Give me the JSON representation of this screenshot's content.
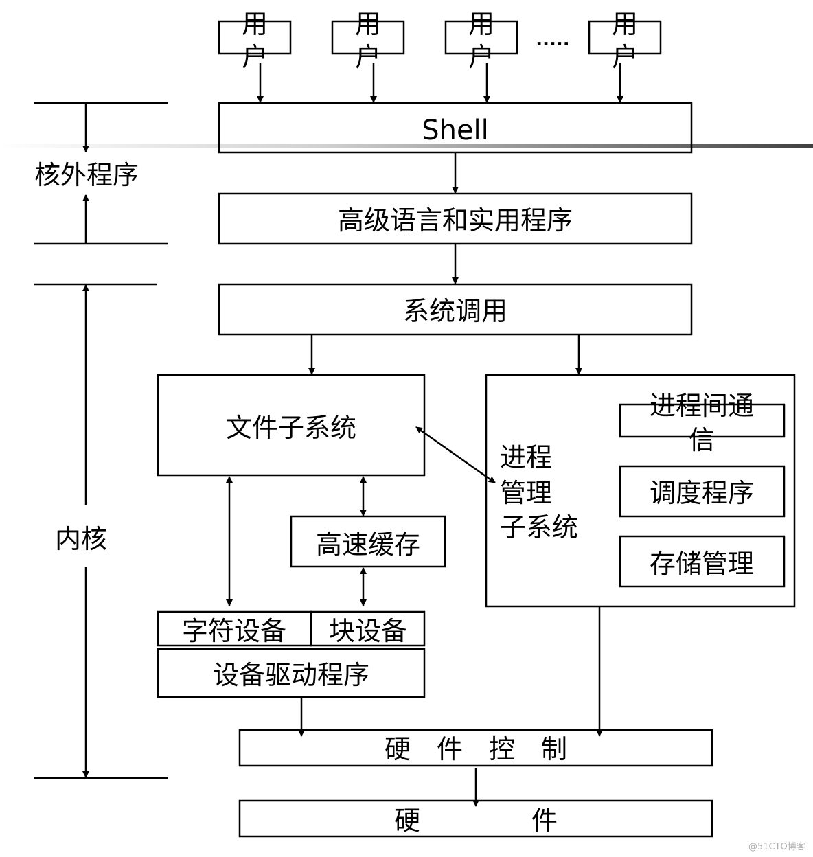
{
  "users": [
    {
      "line1": "用",
      "line2": "户"
    },
    {
      "line1": "用",
      "line2": "户"
    },
    {
      "line1": "用",
      "line2": "户"
    },
    {
      "line1": "用",
      "line2": "户"
    }
  ],
  "ellipsis": ".....",
  "shell": "Shell",
  "outer_label": "核外程序",
  "kernel_label": "内核",
  "hll": "高级语言和实用程序",
  "syscall": "系统调用",
  "filesys": "文件子系统",
  "process": {
    "line1": "进程",
    "line2": "管理",
    "line3": "子系统"
  },
  "ipc": {
    "line1": "进程间通",
    "line2": "信"
  },
  "scheduler": "调度程序",
  "memory": "存储管理",
  "cache": "高速缓存",
  "char_dev": "字符设备",
  "block_dev": "块设备",
  "driver": "设备驱动程序",
  "hw_control": "硬　件　控　制",
  "hardware": {
    "part1": "硬",
    "part2": "件"
  },
  "watermark": "@51CTO博客",
  "colors": {
    "line": "#000000",
    "watermark": "#b0b0b0"
  }
}
